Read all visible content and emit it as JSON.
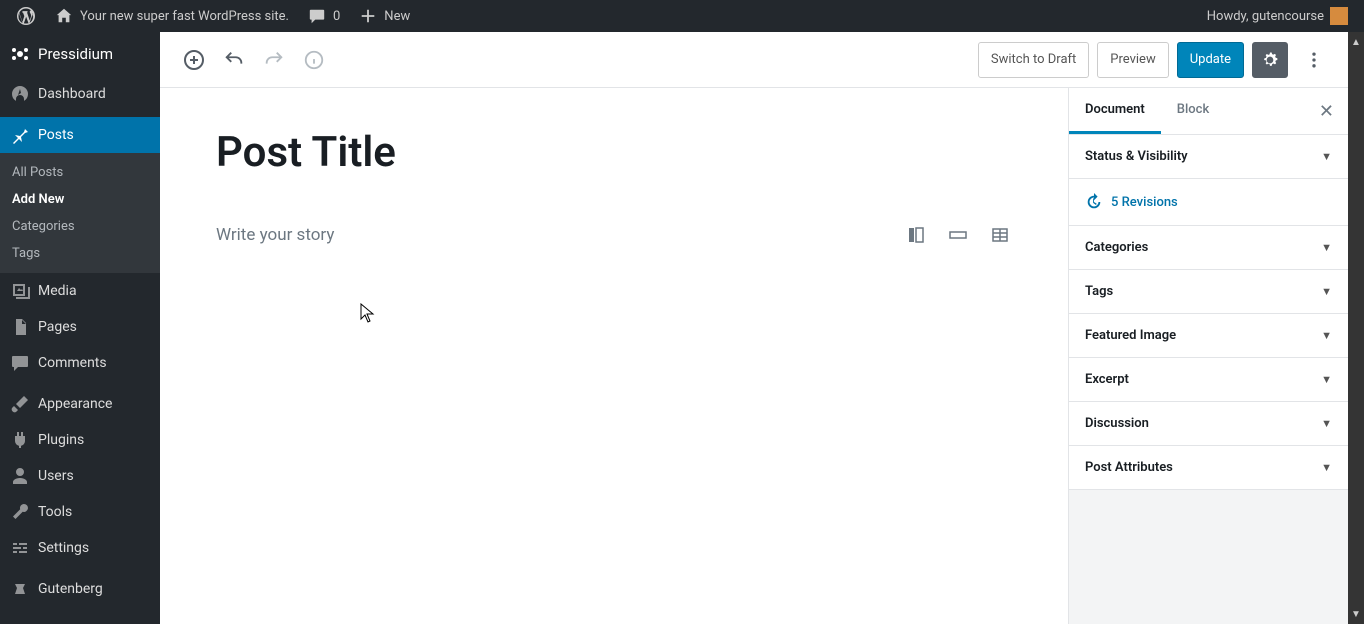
{
  "adminbar": {
    "site_name": "Your new super fast WordPress site.",
    "comments_count": "0",
    "new_label": "New",
    "howdy_prefix": "Howdy, ",
    "username": "gutencourse"
  },
  "sidebar": {
    "brand": "Pressidium",
    "items": [
      {
        "label": "Dashboard"
      },
      {
        "label": "Posts",
        "active": true
      },
      {
        "label": "Media"
      },
      {
        "label": "Pages"
      },
      {
        "label": "Comments"
      },
      {
        "label": "Appearance"
      },
      {
        "label": "Plugins"
      },
      {
        "label": "Users"
      },
      {
        "label": "Tools"
      },
      {
        "label": "Settings"
      },
      {
        "label": "Gutenberg"
      }
    ],
    "posts_submenu": [
      {
        "label": "All Posts"
      },
      {
        "label": "Add New",
        "current": true
      },
      {
        "label": "Categories"
      },
      {
        "label": "Tags"
      }
    ]
  },
  "toolbar": {
    "switch_draft": "Switch to Draft",
    "preview": "Preview",
    "update": "Update"
  },
  "editor": {
    "title": "Post Title",
    "prompt": "Write your story"
  },
  "settings": {
    "tabs": {
      "document": "Document",
      "block": "Block"
    },
    "status_visibility": "Status & Visibility",
    "revisions": "5 Revisions",
    "categories": "Categories",
    "tags": "Tags",
    "featured_image": "Featured Image",
    "excerpt": "Excerpt",
    "discussion": "Discussion",
    "post_attributes": "Post Attributes"
  }
}
